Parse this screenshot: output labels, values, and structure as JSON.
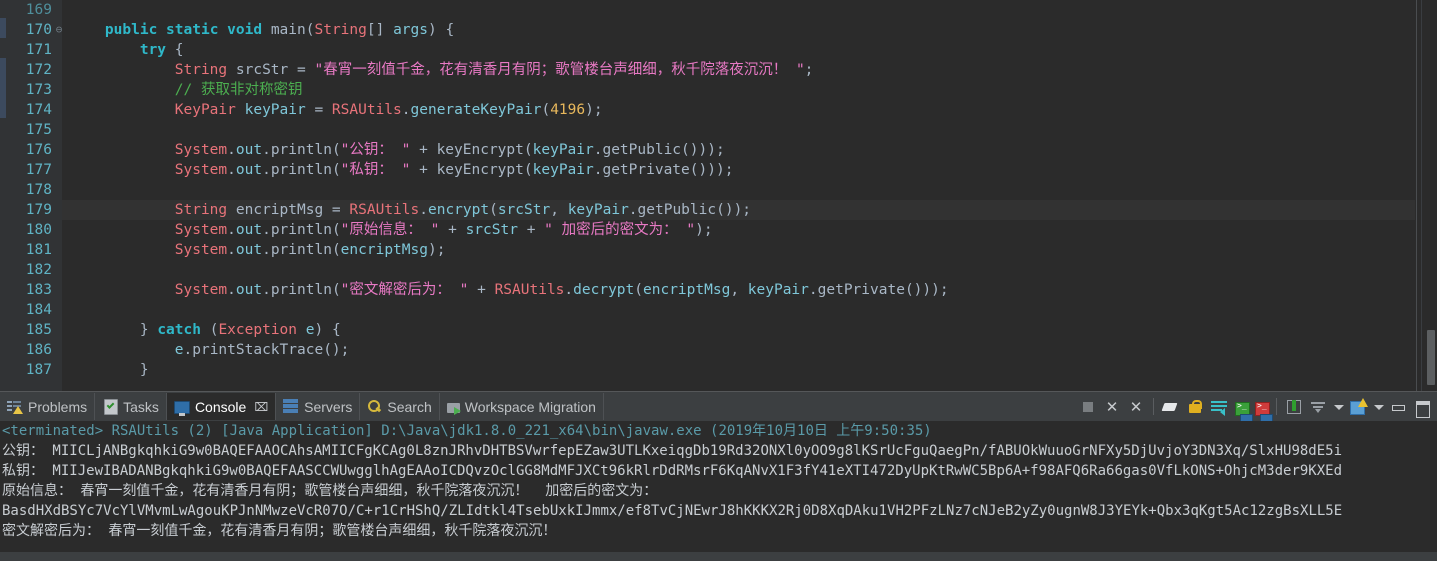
{
  "editor": {
    "lines": [
      {
        "num": "169",
        "dim": true,
        "fold": "",
        "highlight": false,
        "tokens": []
      },
      {
        "num": "170",
        "dim": false,
        "fold": "⊖",
        "highlight": false,
        "tokens": [
          {
            "t": "    ",
            "c": "pl"
          },
          {
            "t": "public",
            "c": "kw2"
          },
          {
            "t": " ",
            "c": "pl"
          },
          {
            "t": "static",
            "c": "kw2"
          },
          {
            "t": " ",
            "c": "pl"
          },
          {
            "t": "void",
            "c": "kw2"
          },
          {
            "t": " ",
            "c": "pl"
          },
          {
            "t": "main",
            "c": "pl"
          },
          {
            "t": "(",
            "c": "pl"
          },
          {
            "t": "String",
            "c": "cls"
          },
          {
            "t": "[] ",
            "c": "pl"
          },
          {
            "t": "args",
            "c": "var"
          },
          {
            "t": ") {",
            "c": "pl"
          }
        ]
      },
      {
        "num": "171",
        "dim": false,
        "fold": "",
        "highlight": false,
        "tokens": [
          {
            "t": "        ",
            "c": "pl"
          },
          {
            "t": "try",
            "c": "kw2"
          },
          {
            "t": " {",
            "c": "pl"
          }
        ]
      },
      {
        "num": "172",
        "dim": false,
        "fold": "",
        "highlight": false,
        "tokens": [
          {
            "t": "            ",
            "c": "pl"
          },
          {
            "t": "String",
            "c": "cls"
          },
          {
            "t": " ",
            "c": "pl"
          },
          {
            "t": "srcStr",
            "c": "pl"
          },
          {
            "t": " = ",
            "c": "pl"
          },
          {
            "t": "\"春宵一刻值千金，花有清香月有阴；歌管楼台声细细，秋千院落夜沉沉！ \"",
            "c": "str"
          },
          {
            "t": ";",
            "c": "pl"
          }
        ]
      },
      {
        "num": "173",
        "dim": false,
        "fold": "",
        "highlight": false,
        "tokens": [
          {
            "t": "            ",
            "c": "pl"
          },
          {
            "t": "// 获取非对称密钥",
            "c": "cmt"
          }
        ]
      },
      {
        "num": "174",
        "dim": false,
        "fold": "",
        "highlight": false,
        "tokens": [
          {
            "t": "            ",
            "c": "pl"
          },
          {
            "t": "KeyPair",
            "c": "cls"
          },
          {
            "t": " ",
            "c": "pl"
          },
          {
            "t": "keyPair",
            "c": "var"
          },
          {
            "t": " = ",
            "c": "pl"
          },
          {
            "t": "RSAUtils",
            "c": "cls"
          },
          {
            "t": ".",
            "c": "pl"
          },
          {
            "t": "generateKeyPair",
            "c": "var"
          },
          {
            "t": "(",
            "c": "pl"
          },
          {
            "t": "4196",
            "c": "num"
          },
          {
            "t": ");",
            "c": "pl"
          }
        ]
      },
      {
        "num": "175",
        "dim": false,
        "fold": "",
        "highlight": false,
        "tokens": []
      },
      {
        "num": "176",
        "dim": false,
        "fold": "",
        "highlight": false,
        "tokens": [
          {
            "t": "            ",
            "c": "pl"
          },
          {
            "t": "System",
            "c": "cls"
          },
          {
            "t": ".",
            "c": "pl"
          },
          {
            "t": "out",
            "c": "var"
          },
          {
            "t": ".",
            "c": "pl"
          },
          {
            "t": "println",
            "c": "pl"
          },
          {
            "t": "(",
            "c": "pl"
          },
          {
            "t": "\"公钥： \"",
            "c": "str"
          },
          {
            "t": " + ",
            "c": "pl"
          },
          {
            "t": "keyEncrypt",
            "c": "pl"
          },
          {
            "t": "(",
            "c": "pl"
          },
          {
            "t": "keyPair",
            "c": "var"
          },
          {
            "t": ".",
            "c": "pl"
          },
          {
            "t": "getPublic",
            "c": "pl"
          },
          {
            "t": "()));",
            "c": "pl"
          }
        ]
      },
      {
        "num": "177",
        "dim": false,
        "fold": "",
        "highlight": false,
        "tokens": [
          {
            "t": "            ",
            "c": "pl"
          },
          {
            "t": "System",
            "c": "cls"
          },
          {
            "t": ".",
            "c": "pl"
          },
          {
            "t": "out",
            "c": "var"
          },
          {
            "t": ".",
            "c": "pl"
          },
          {
            "t": "println",
            "c": "pl"
          },
          {
            "t": "(",
            "c": "pl"
          },
          {
            "t": "\"私钥： \"",
            "c": "str"
          },
          {
            "t": " + ",
            "c": "pl"
          },
          {
            "t": "keyEncrypt",
            "c": "pl"
          },
          {
            "t": "(",
            "c": "pl"
          },
          {
            "t": "keyPair",
            "c": "var"
          },
          {
            "t": ".",
            "c": "pl"
          },
          {
            "t": "getPrivate",
            "c": "pl"
          },
          {
            "t": "()));",
            "c": "pl"
          }
        ]
      },
      {
        "num": "178",
        "dim": false,
        "fold": "",
        "highlight": false,
        "tokens": []
      },
      {
        "num": "179",
        "dim": false,
        "fold": "",
        "highlight": true,
        "tokens": [
          {
            "t": "            ",
            "c": "pl"
          },
          {
            "t": "String",
            "c": "cls"
          },
          {
            "t": " ",
            "c": "pl"
          },
          {
            "t": "encriptMsg",
            "c": "pl"
          },
          {
            "t": " = ",
            "c": "pl"
          },
          {
            "t": "RSAUtils",
            "c": "cls"
          },
          {
            "t": ".",
            "c": "pl"
          },
          {
            "t": "encrypt",
            "c": "var"
          },
          {
            "t": "(",
            "c": "pl"
          },
          {
            "t": "srcStr",
            "c": "var"
          },
          {
            "t": ", ",
            "c": "pl"
          },
          {
            "t": "keyPair",
            "c": "var"
          },
          {
            "t": ".",
            "c": "pl"
          },
          {
            "t": "getPublic",
            "c": "pl"
          },
          {
            "t": "());",
            "c": "pl"
          }
        ]
      },
      {
        "num": "180",
        "dim": false,
        "fold": "",
        "highlight": false,
        "tokens": [
          {
            "t": "            ",
            "c": "pl"
          },
          {
            "t": "System",
            "c": "cls"
          },
          {
            "t": ".",
            "c": "pl"
          },
          {
            "t": "out",
            "c": "var"
          },
          {
            "t": ".",
            "c": "pl"
          },
          {
            "t": "println",
            "c": "pl"
          },
          {
            "t": "(",
            "c": "pl"
          },
          {
            "t": "\"原始信息： \"",
            "c": "str"
          },
          {
            "t": " + ",
            "c": "pl"
          },
          {
            "t": "srcStr",
            "c": "var"
          },
          {
            "t": " + ",
            "c": "pl"
          },
          {
            "t": "\" 加密后的密文为： \"",
            "c": "str"
          },
          {
            "t": ");",
            "c": "pl"
          }
        ]
      },
      {
        "num": "181",
        "dim": false,
        "fold": "",
        "highlight": false,
        "tokens": [
          {
            "t": "            ",
            "c": "pl"
          },
          {
            "t": "System",
            "c": "cls"
          },
          {
            "t": ".",
            "c": "pl"
          },
          {
            "t": "out",
            "c": "var"
          },
          {
            "t": ".",
            "c": "pl"
          },
          {
            "t": "println",
            "c": "pl"
          },
          {
            "t": "(",
            "c": "pl"
          },
          {
            "t": "encriptMsg",
            "c": "var"
          },
          {
            "t": ");",
            "c": "pl"
          }
        ]
      },
      {
        "num": "182",
        "dim": false,
        "fold": "",
        "highlight": false,
        "tokens": []
      },
      {
        "num": "183",
        "dim": false,
        "fold": "",
        "highlight": false,
        "tokens": [
          {
            "t": "            ",
            "c": "pl"
          },
          {
            "t": "System",
            "c": "cls"
          },
          {
            "t": ".",
            "c": "pl"
          },
          {
            "t": "out",
            "c": "var"
          },
          {
            "t": ".",
            "c": "pl"
          },
          {
            "t": "println",
            "c": "pl"
          },
          {
            "t": "(",
            "c": "pl"
          },
          {
            "t": "\"密文解密后为： \"",
            "c": "str"
          },
          {
            "t": " + ",
            "c": "pl"
          },
          {
            "t": "RSAUtils",
            "c": "cls"
          },
          {
            "t": ".",
            "c": "pl"
          },
          {
            "t": "decrypt",
            "c": "var"
          },
          {
            "t": "(",
            "c": "pl"
          },
          {
            "t": "encriptMsg",
            "c": "var"
          },
          {
            "t": ", ",
            "c": "pl"
          },
          {
            "t": "keyPair",
            "c": "var"
          },
          {
            "t": ".",
            "c": "pl"
          },
          {
            "t": "getPrivate",
            "c": "pl"
          },
          {
            "t": "()));",
            "c": "pl"
          }
        ]
      },
      {
        "num": "184",
        "dim": false,
        "fold": "",
        "highlight": false,
        "tokens": []
      },
      {
        "num": "185",
        "dim": false,
        "fold": "",
        "highlight": false,
        "tokens": [
          {
            "t": "        } ",
            "c": "pl"
          },
          {
            "t": "catch",
            "c": "kw2"
          },
          {
            "t": " (",
            "c": "pl"
          },
          {
            "t": "Exception",
            "c": "cls"
          },
          {
            "t": " ",
            "c": "pl"
          },
          {
            "t": "e",
            "c": "var"
          },
          {
            "t": ") {",
            "c": "pl"
          }
        ]
      },
      {
        "num": "186",
        "dim": false,
        "fold": "",
        "highlight": false,
        "tokens": [
          {
            "t": "            ",
            "c": "pl"
          },
          {
            "t": "e",
            "c": "var"
          },
          {
            "t": ".",
            "c": "pl"
          },
          {
            "t": "printStackTrace",
            "c": "pl"
          },
          {
            "t": "();",
            "c": "pl"
          }
        ]
      },
      {
        "num": "187",
        "dim": false,
        "fold": "",
        "highlight": false,
        "tokens": [
          {
            "t": "        }",
            "c": "pl"
          }
        ]
      }
    ]
  },
  "panel": {
    "tabs": [
      {
        "label": "Problems",
        "icon": "problems-icon",
        "active": false,
        "closable": false
      },
      {
        "label": "Tasks",
        "icon": "tasks-icon",
        "active": false,
        "closable": false
      },
      {
        "label": "Console",
        "icon": "console-icon",
        "active": true,
        "closable": true,
        "close_glyph": "⌧"
      },
      {
        "label": "Servers",
        "icon": "servers-icon",
        "active": false,
        "closable": false
      },
      {
        "label": "Search",
        "icon": "search-icon",
        "active": false,
        "closable": false
      },
      {
        "label": "Workspace Migration",
        "icon": "migration-icon",
        "active": false,
        "closable": false
      }
    ],
    "toolbar": [
      {
        "name": "terminate-button",
        "kind": "stop"
      },
      {
        "name": "remove-launch-button",
        "kind": "x",
        "glyph": "✕"
      },
      {
        "name": "remove-all-terminated-button",
        "kind": "xx",
        "glyph": "✕"
      },
      {
        "name": "separator-1",
        "kind": "sep"
      },
      {
        "name": "clear-console-button",
        "kind": "eraser"
      },
      {
        "name": "scroll-lock-button",
        "kind": "lock"
      },
      {
        "name": "word-wrap-button",
        "kind": "wrap"
      },
      {
        "name": "show-console-stdout-button",
        "kind": "green"
      },
      {
        "name": "show-console-stderr-button",
        "kind": "red"
      },
      {
        "name": "separator-2",
        "kind": "sep"
      },
      {
        "name": "pin-console-button",
        "kind": "pin"
      },
      {
        "name": "display-selected-console-button",
        "kind": "scroll"
      },
      {
        "name": "display-selected-console-dropdown",
        "kind": "caret"
      },
      {
        "name": "open-console-button",
        "kind": "newcon"
      },
      {
        "name": "open-console-dropdown",
        "kind": "caret"
      },
      {
        "name": "minimize-panel-button",
        "kind": "min"
      },
      {
        "name": "maximize-panel-button",
        "kind": "max"
      }
    ],
    "console": {
      "status_line": "<terminated> RSAUtils (2) [Java Application] D:\\Java\\jdk1.8.0_221_x64\\bin\\javaw.exe (2019年10月10日 上午9:50:35)",
      "lines": [
        "公钥： MIICLjANBgkqhkiG9w0BAQEFAAOCAhsAMIICFgKCAg0L8znJRhvDHTBSVwrfepEZaw3UTLKxeiqgDb19Rd32ONXl0yOO9g8lKSrUcFguQaegPn/fABUOkWuuoGrNFXy5DjUvjoY3DN3Xq/SlxHU98dE5i",
        "私钥： MIIJewIBADANBgkqhkiG9w0BAQEFAASCCWUwgglhAgEAAoICDQvzOclGG8MdMFJXCt96kRlrDdRMsrF6KqANvX1F3fY41eXTI472DyUpKtRwWC5Bp6A+f98AFQ6Ra66gas0VfLkONS+OhjcM3der9KXEd",
        "原始信息： 春宵一刻值千金，花有清香月有阴；歌管楼台声细细，秋千院落夜沉沉！  加密后的密文为：",
        "BasdHXdBSYc7VcYlVMvmLwAgouKPJnNMwzeVcR07O/C+r1CrHShQ/ZLIdtkl4TsebUxkIJmmx/ef8TvCjNEwrJ8hKKKX2Rj0D8XqDAku1VH2PFzLNz7cNJeB2yZy0ugnW8J3YEYk+Qbx3qKgt5Ac12zgBsXLL5E",
        "密文解密后为： 春宵一刻值千金，花有清香月有阴；歌管楼台声细细，秋千院落夜沉沉！"
      ]
    }
  },
  "colors": {
    "editor_bg": "#2b2b2b",
    "gutter_bg": "#313335",
    "panel_bg": "#3c3f41",
    "line_number": "#5fb3c4",
    "keyword": "#2fb8c9",
    "class": "#e8737a",
    "string": "#e879c4",
    "comment": "#4caf50",
    "number": "#e8b85c",
    "variable": "#7fc7d9",
    "plain": "#a9b7c6",
    "console_meta": "#5a9aa8",
    "console_out": "#c8cdd2",
    "highlight_row": "#323232"
  }
}
